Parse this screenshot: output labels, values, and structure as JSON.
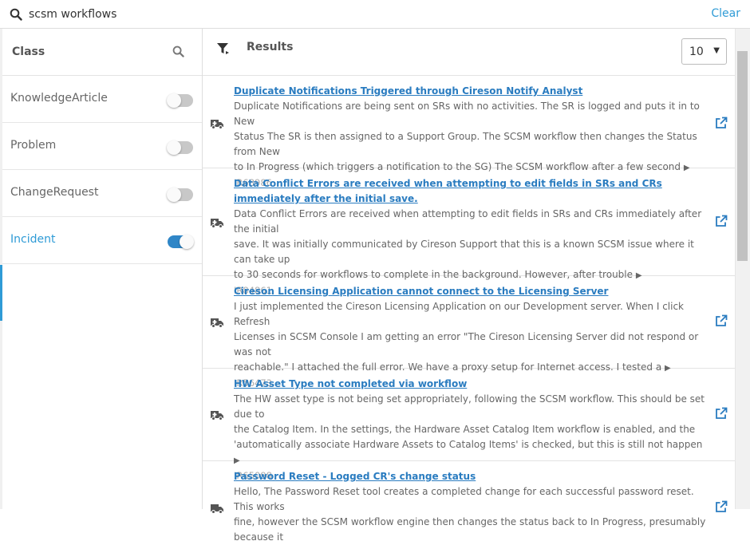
{
  "search": {
    "query": "scsm workflows",
    "clear_label": "Clear"
  },
  "class_panel": {
    "title": "Class",
    "items": [
      {
        "label": "KnowledgeArticle",
        "enabled": false
      },
      {
        "label": "Problem",
        "enabled": false
      },
      {
        "label": "ChangeRequest",
        "enabled": false
      },
      {
        "label": "Incident",
        "enabled": true
      }
    ]
  },
  "results_panel": {
    "title": "Results",
    "page_size": "10",
    "items": [
      {
        "title": "Duplicate Notifications Triggered through Cireson Notify Analyst",
        "desc_lines": [
          "Duplicate Notifications are being sent on SRs with no activities. The SR is logged and puts it in to New",
          "Status The SR is then assigned to a Support Group. The SCSM workflow then changes the Status from New",
          "to In Progress (which triggers a notification to the SG) The SCSM workflow after a few second"
        ],
        "id": "IR68986"
      },
      {
        "title": "Data Conflict Errors are received when attempting to edit fields in SRs and CRs immediately after the initial save.",
        "desc_lines": [
          "Data Conflict Errors are received when attempting to edit fields in SRs and CRs immediately after the initial",
          "save. It was initially communicated by Cireson Support that this is a known SCSM issue where it can take up",
          "to 30 seconds for workflows to complete in the background. However, after trouble"
        ],
        "id": "IR84861"
      },
      {
        "title": "Cireson Licensing Application cannot connect to the Licensing Server",
        "desc_lines": [
          "I just implemented the Cireson Licensing Application on our Development server. When I click Refresh",
          "Licenses in SCSM Console I am getting an error \"The Cireson Licensing Server did not respond or was not",
          "reachable.\" I attached the full error. We have a proxy setup for Internet access. I tested a"
        ],
        "id": "IR56473"
      },
      {
        "title": "HW Asset Type not completed via workflow",
        "desc_lines": [
          "The HW asset type is not being set appropriately, following the SCSM workflow. This should be set due to",
          "the Catalog Item. In the settings, the Hardware Asset Catalog Item workflow is enabled, and the",
          "'automatically associate Hardware Assets to Catalog Items' is checked, but this is still not happen"
        ],
        "id": "IR65098"
      },
      {
        "title": "Password Reset - Logged CR's change status",
        "desc_lines": [
          "Hello, The Password Reset tool creates a completed change for each successful password reset. This works",
          "fine, however the SCSM workflow engine then changes the status back to In Progress, presumably because it"
        ],
        "id": ""
      }
    ]
  },
  "icons": {
    "search": "magnifier-icon",
    "filter": "filter-icon",
    "incident": "ambulance-icon",
    "open": "external-link-icon",
    "more": "triangle-right-icon"
  },
  "colors": {
    "accent": "#2f9bd6",
    "link": "#2a7cc0",
    "toggle_on": "#2f86c7"
  }
}
